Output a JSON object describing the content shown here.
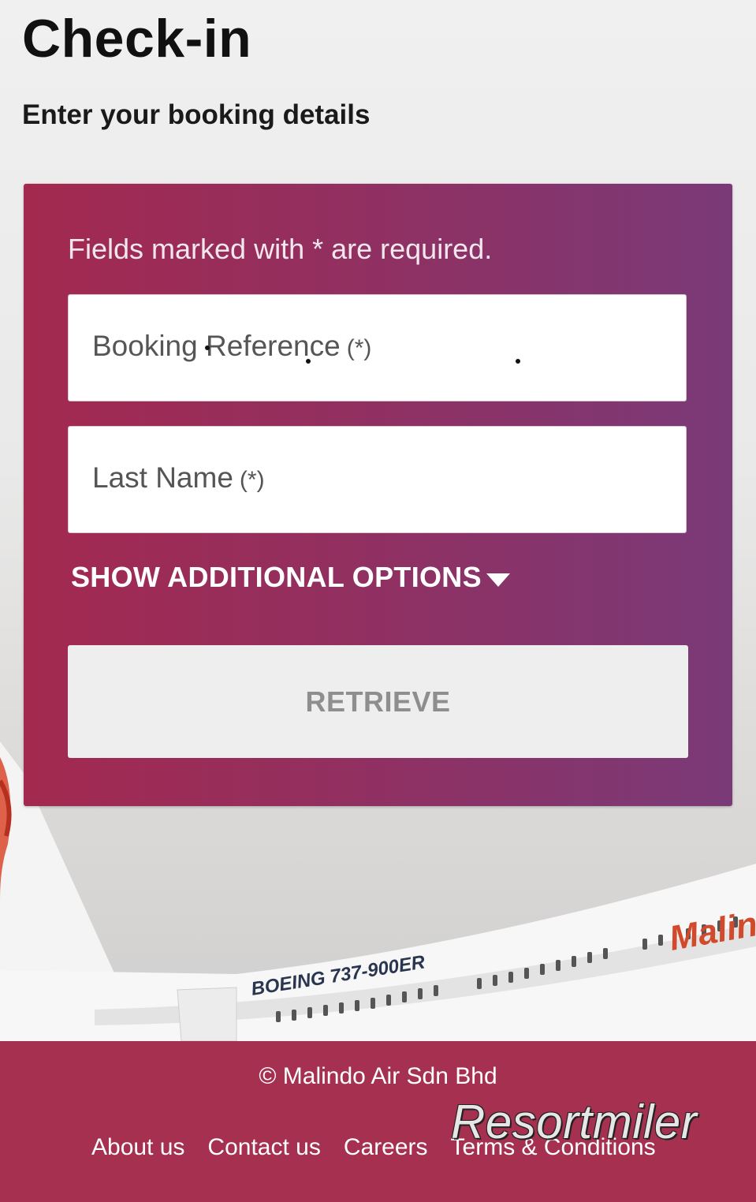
{
  "page": {
    "title": "Check-in",
    "subtitle": "Enter your booking details"
  },
  "form": {
    "required_note": "Fields marked with * are required.",
    "booking_reference": {
      "label": "Booking Reference",
      "required_marker": "(*)"
    },
    "last_name": {
      "label": "Last Name",
      "required_marker": "(*)"
    },
    "additional_options_label": "SHOW ADDITIONAL OPTIONS",
    "retrieve_label": "RETRIEVE"
  },
  "aircraft": {
    "livery_text": "BOEING 737-900ER",
    "brand_text": "Malin"
  },
  "footer": {
    "copyright": "© Malindo Air Sdn Bhd",
    "links": [
      "About us",
      "Contact us",
      "Careers",
      "Terms & Conditions"
    ],
    "watermark": "Resortmiler"
  },
  "colors": {
    "card_gradient_start": "#a3294f",
    "card_gradient_end": "#7a3a78",
    "footer_bg": "#a6304f",
    "retrieve_bg": "#eeeeee",
    "retrieve_text": "#8e8e8e"
  }
}
